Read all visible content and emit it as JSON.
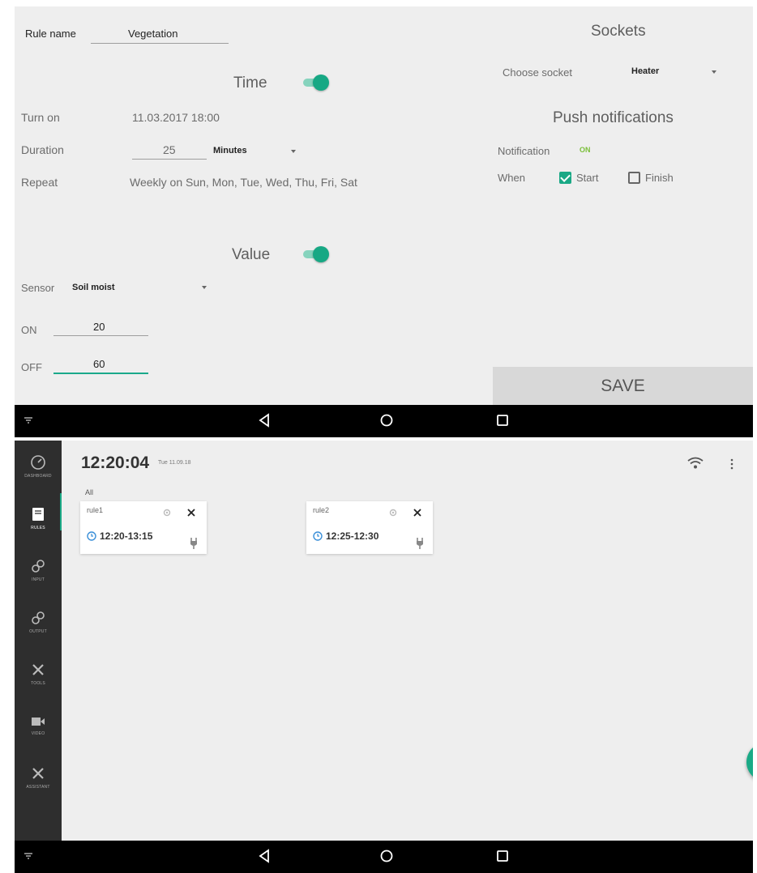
{
  "rule_form": {
    "rule_name_label": "Rule name",
    "rule_name_value": "Vegetation",
    "time_section": {
      "title": "Time",
      "enabled": true,
      "turn_on_label": "Turn on",
      "turn_on_value": "11.03.2017 18:00",
      "duration_label": "Duration",
      "duration_value": "25",
      "duration_unit": "Minutes",
      "repeat_label": "Repeat",
      "repeat_value": "Weekly on Sun, Mon, Tue, Wed, Thu, Fri, Sat"
    },
    "value_section": {
      "title": "Value",
      "enabled": true,
      "sensor_label": "Sensor",
      "sensor_value": "Soil moist",
      "on_label": "ON",
      "on_value": "20",
      "off_label": "OFF",
      "off_value": "60"
    },
    "sockets": {
      "title": "Sockets",
      "choose_label": "Choose socket",
      "choose_value": "Heater"
    },
    "push": {
      "title": "Push notifications",
      "notification_label": "Notification",
      "notification_status": "ON",
      "when_label": "When",
      "start_label": "Start",
      "start_checked": true,
      "finish_label": "Finish",
      "finish_checked": false
    },
    "save_label": "SAVE"
  },
  "dashboard": {
    "clock": "12:20:04",
    "date": "Tue 11.09.18",
    "filter_label": "All",
    "sidebar": [
      {
        "caption": "DASHBOARD",
        "icon": "gauge-icon"
      },
      {
        "caption": "RULES",
        "icon": "book-icon"
      },
      {
        "caption": "INPUT",
        "icon": "link-icon"
      },
      {
        "caption": "OUTPUT",
        "icon": "link-icon"
      },
      {
        "caption": "TOOLS",
        "icon": "tools-icon"
      },
      {
        "caption": "VIDEO",
        "icon": "video-icon"
      },
      {
        "caption": "ASSISTANT",
        "icon": "tools-icon"
      }
    ],
    "rules": [
      {
        "name": "rule1",
        "time": "12:20-13:15"
      },
      {
        "name": "rule2",
        "time": "12:25-12:30"
      }
    ],
    "fab_label": "+"
  },
  "colors": {
    "accent": "#19a885",
    "panel_bg": "#eeeeee",
    "sidebar_bg": "#2e2e2e",
    "nav_bar": "#000000"
  }
}
